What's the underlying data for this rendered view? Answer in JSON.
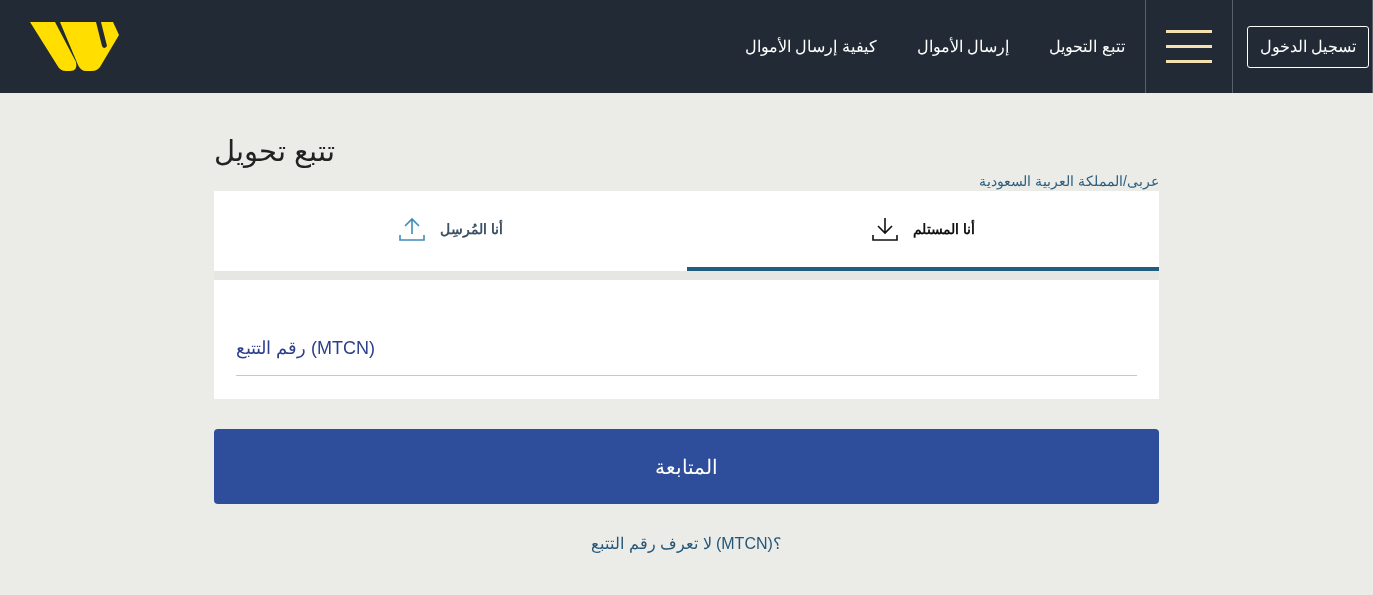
{
  "header": {
    "nav_links": [
      "تتبع التحويل",
      "إرسال الأموال",
      "كيفية إرسال الأموال"
    ],
    "login_button": "تسجيل الدخول"
  },
  "page": {
    "title": "تتبع تحويل",
    "locale": "عربى/المملكة العربية السعودية"
  },
  "tabs": [
    {
      "label": "أنا المستلم",
      "kind": "download",
      "selected": true
    },
    {
      "label": "أنا المُرسِل",
      "kind": "upload",
      "selected": false
    }
  ],
  "field": {
    "placeholder": "رقم التتبع (MTCN)"
  },
  "continue_button": "المتابعة",
  "help_link": "لا تعرف رقم التتبع (MTCN)؟"
}
